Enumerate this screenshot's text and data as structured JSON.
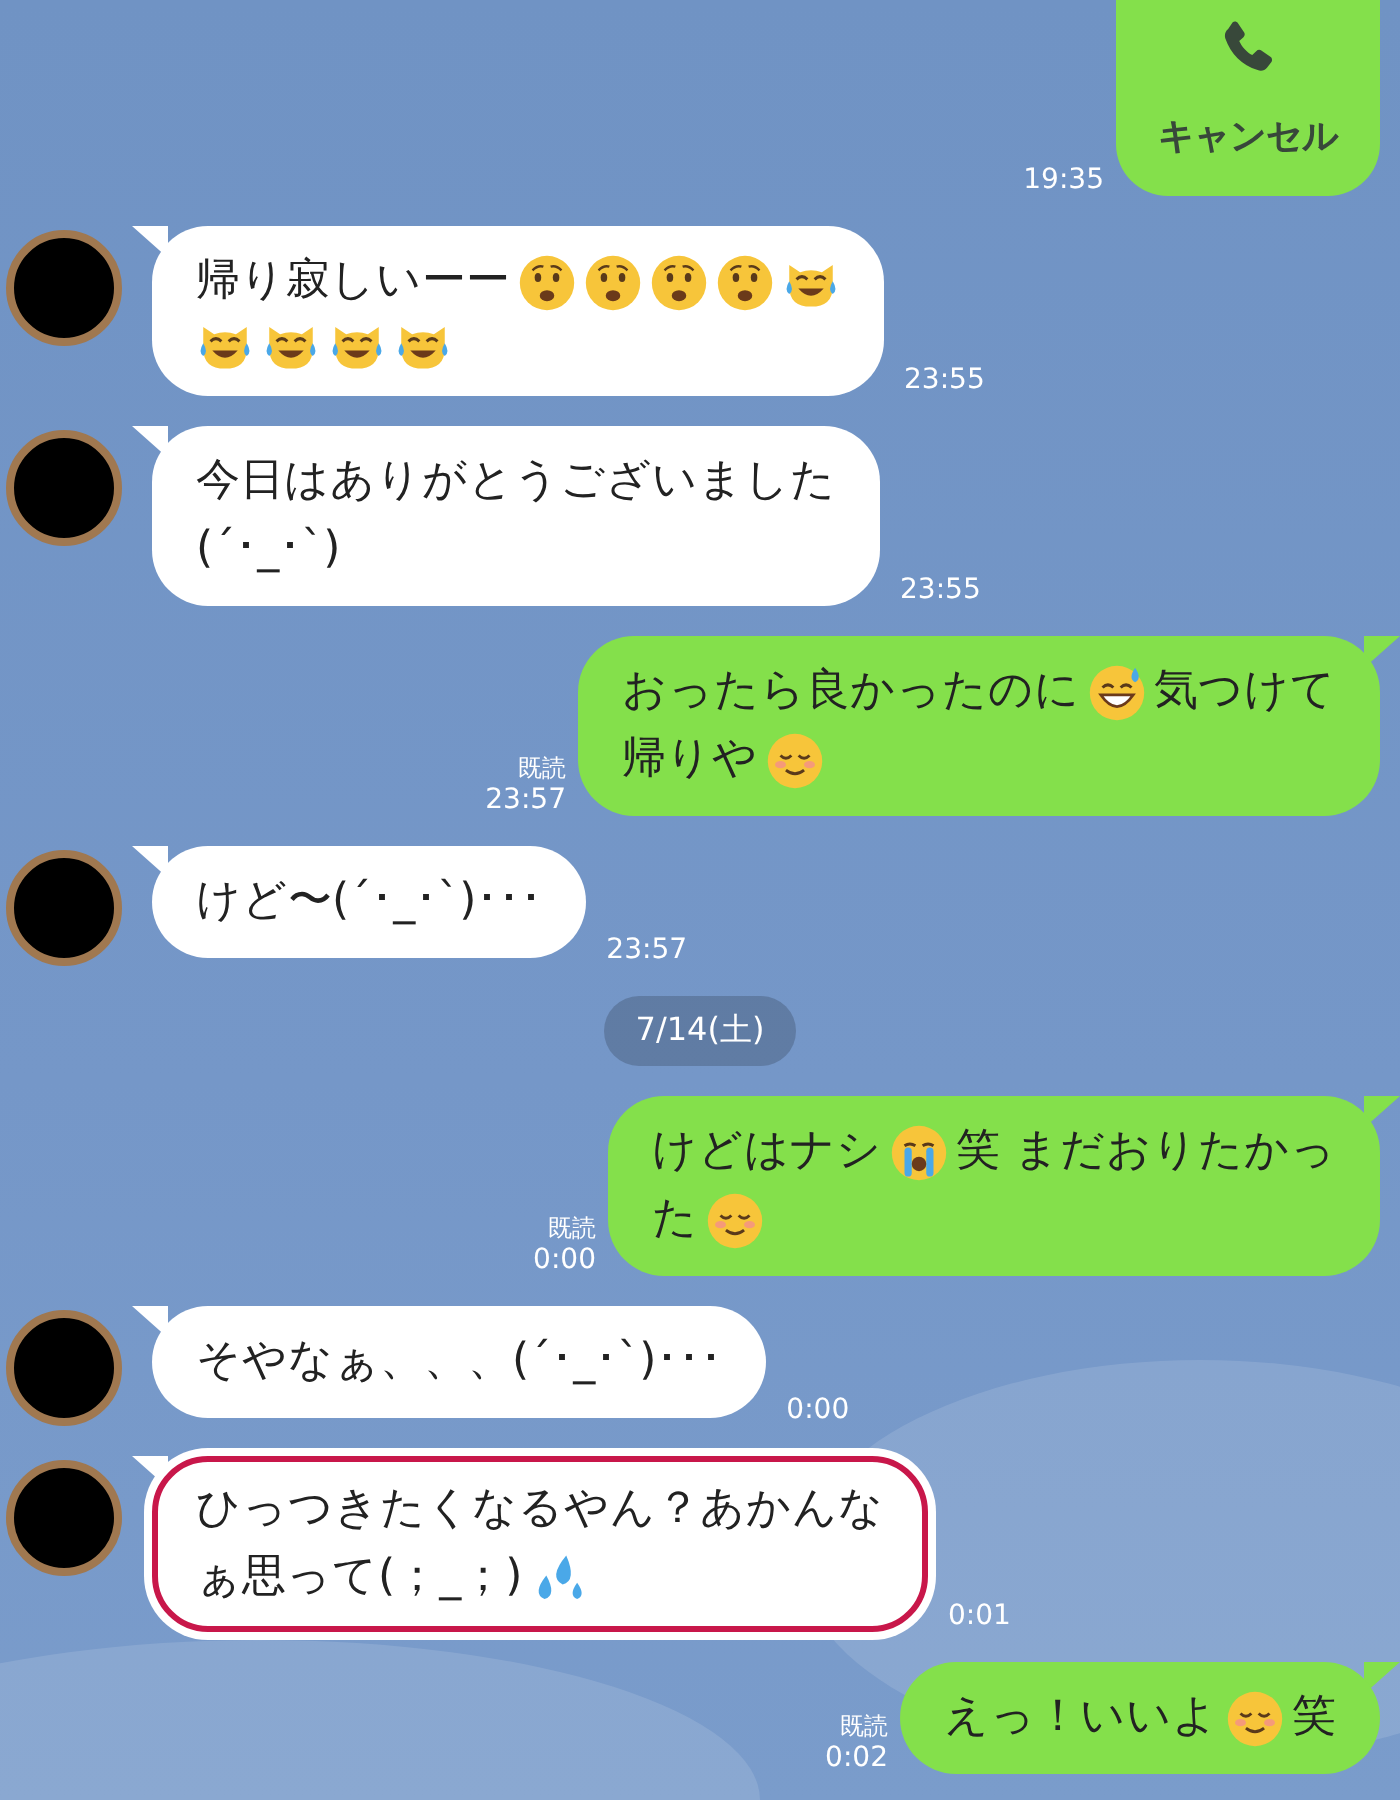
{
  "messages": [
    {
      "kind": "call",
      "label": "キャンセル",
      "time": "19:35"
    },
    {
      "kind": "incoming",
      "highlighted": false,
      "time": "23:55",
      "lines": [
        [
          {
            "kind": "text",
            "text": "帰り寂しいーー"
          },
          {
            "kind": "anguished"
          },
          {
            "kind": "anguished"
          },
          {
            "kind": "anguished"
          },
          {
            "kind": "anguished"
          },
          {
            "kind": "cat-joy"
          }
        ],
        [
          {
            "kind": "cat-joy"
          },
          {
            "kind": "cat-joy"
          },
          {
            "kind": "cat-joy"
          },
          {
            "kind": "cat-joy"
          }
        ]
      ]
    },
    {
      "kind": "incoming",
      "highlighted": false,
      "time": "23:55",
      "lines": [
        [
          {
            "kind": "text",
            "text": "今日はありがとうございました"
          }
        ],
        [
          {
            "kind": "text",
            "text": "(´･_･`)"
          }
        ]
      ]
    },
    {
      "kind": "outgoing",
      "read": "既読",
      "time": "23:57",
      "lines": [
        [
          {
            "kind": "text",
            "text": "おったら良かったのに"
          },
          {
            "kind": "sweat-smile"
          },
          {
            "kind": "text",
            "text": "気つけて"
          }
        ],
        [
          {
            "kind": "text",
            "text": "帰りや"
          },
          {
            "kind": "smiling"
          }
        ]
      ]
    },
    {
      "kind": "incoming",
      "highlighted": false,
      "time": "23:57",
      "lines": [
        [
          {
            "kind": "text",
            "text": "けど〜(´･_･`)･･･"
          }
        ]
      ]
    },
    {
      "kind": "date",
      "label": "7/14(土)"
    },
    {
      "kind": "outgoing",
      "read": "既読",
      "time": "0:00",
      "lines": [
        [
          {
            "kind": "text",
            "text": "けどはナシ"
          },
          {
            "kind": "sob"
          },
          {
            "kind": "text",
            "text": "笑  まだおりたかっ"
          }
        ],
        [
          {
            "kind": "text",
            "text": "た"
          },
          {
            "kind": "smiling"
          }
        ]
      ]
    },
    {
      "kind": "incoming",
      "highlighted": false,
      "time": "0:00",
      "lines": [
        [
          {
            "kind": "text",
            "text": "そやなぁ、、、(´･_･`)･･･"
          }
        ]
      ]
    },
    {
      "kind": "incoming",
      "highlighted": true,
      "time": "0:01",
      "lines": [
        [
          {
            "kind": "text",
            "text": "ひっつきたくなるやん？あかんな"
          }
        ],
        [
          {
            "kind": "text",
            "text": "ぁ思って(；_；)"
          },
          {
            "kind": "droplets"
          }
        ]
      ]
    },
    {
      "kind": "outgoing",
      "read": "既読",
      "time": "0:02",
      "lines": [
        [
          {
            "kind": "text",
            "text": "えっ！いいよ"
          },
          {
            "kind": "smiling"
          },
          {
            "kind": "text",
            "text": "笑"
          }
        ]
      ]
    }
  ]
}
